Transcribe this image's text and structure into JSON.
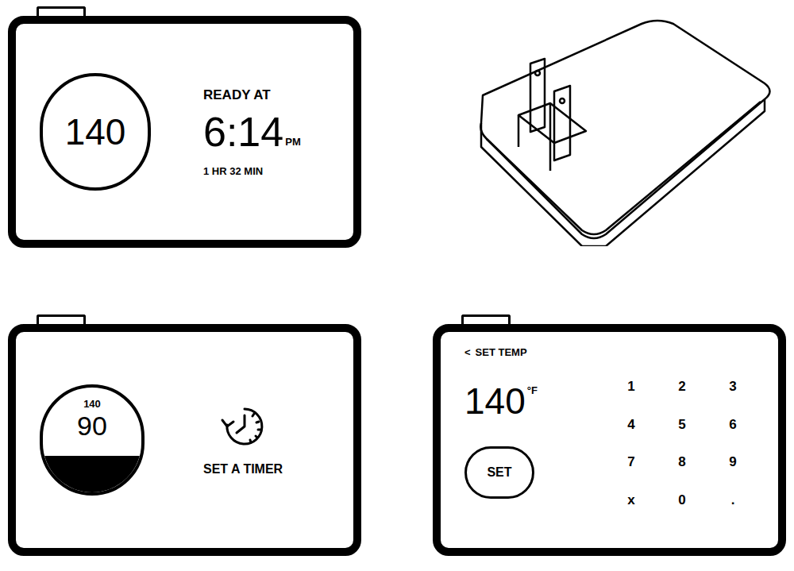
{
  "ready_screen": {
    "temp": "140",
    "label": "READY AT",
    "time": "6:14",
    "meridiem": "PM",
    "remaining": "1 HR 32 MIN"
  },
  "heating_screen": {
    "target": "140",
    "current": "90",
    "level": 0.35,
    "timer_label": "SET A TIMER"
  },
  "set_temp_screen": {
    "back": "<",
    "title": "SET TEMP",
    "value": "140",
    "unit": "°F",
    "set_button": "SET",
    "keys": [
      "1",
      "2",
      "3",
      "4",
      "5",
      "6",
      "7",
      "8",
      "9",
      "x",
      "0",
      "."
    ]
  }
}
